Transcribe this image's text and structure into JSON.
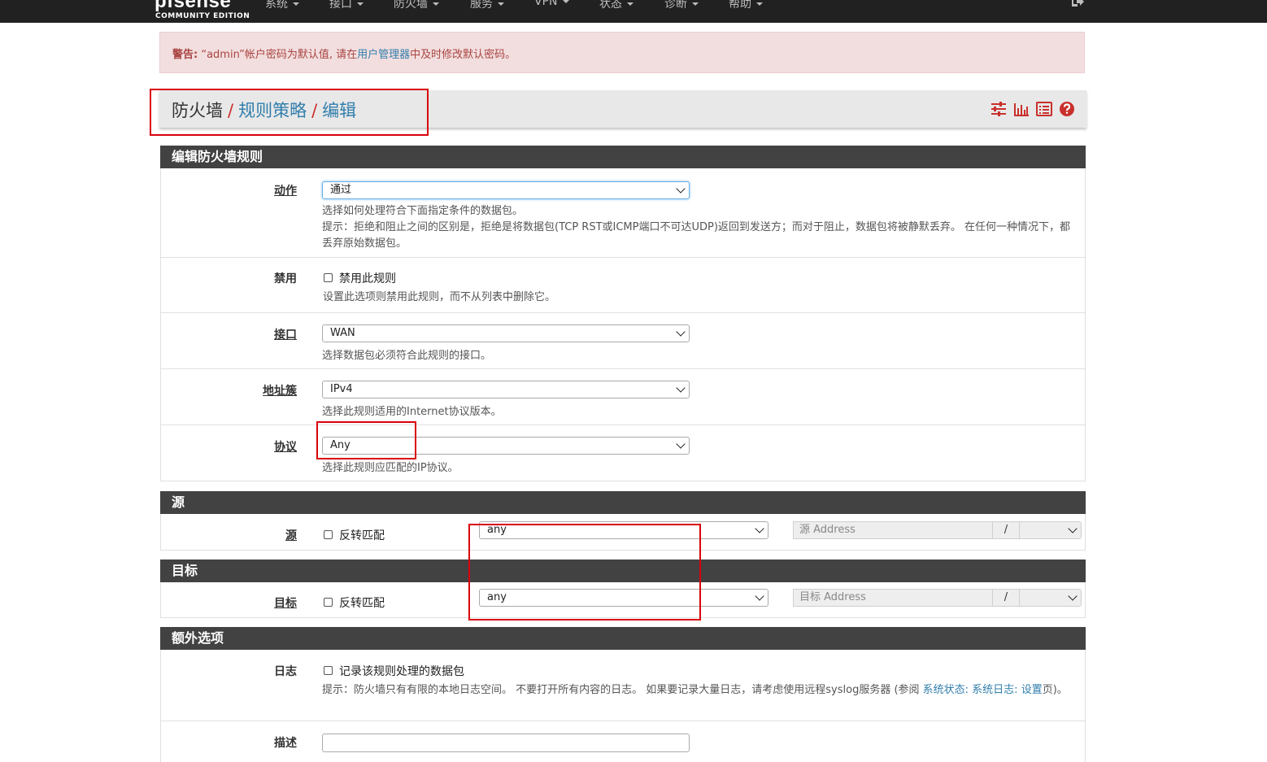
{
  "navbar": {
    "brand": "pfsense",
    "edition": "COMMUNITY EDITION",
    "menus": [
      "系统",
      "接口",
      "防火墙",
      "服务",
      "VPN",
      "状态",
      "诊断",
      "帮助"
    ]
  },
  "alert": {
    "prefix": "警告:",
    "text_before": " “admin”帐户密码为默认值, 请在",
    "link": "用户管理器",
    "text_after": "中及时修改默认密码。"
  },
  "breadcrumb": {
    "root": "防火墙",
    "sep": "/",
    "level2": "规则策略",
    "level3": "编辑"
  },
  "sections": {
    "edit": "编辑防火墙规则",
    "source": "源",
    "destination": "目标",
    "extra": "额外选项"
  },
  "fields": {
    "action": {
      "label": "动作",
      "value": "通过",
      "help1": "选择如何处理符合下面指定条件的数据包。",
      "help2": "提示：拒绝和阻止之间的区别是，拒绝是将数据包(TCP RST或ICMP端口不可达UDP)返回到发送方；而对于阻止，数据包将被静默丢弃。 在任何一种情况下，都丢弃原始数据包。"
    },
    "disabled": {
      "label": "禁用",
      "checkbox": "禁用此规则",
      "help": "设置此选项则禁用此规则，而不从列表中删除它。"
    },
    "interface": {
      "label": "接口",
      "value": "WAN",
      "help": "选择数据包必须符合此规则的接口。"
    },
    "family": {
      "label": "地址簇",
      "value": "IPv4",
      "help": "选择此规则适用的Internet协议版本。"
    },
    "protocol": {
      "label": "协议",
      "value": "Any",
      "help": "选择此规则应匹配的IP协议。"
    },
    "source": {
      "label": "源",
      "invert": "反转匹配",
      "value": "any",
      "address_placeholder": "源 Address",
      "slash": "/"
    },
    "destination": {
      "label": "目标",
      "invert": "反转匹配",
      "value": "any",
      "address_placeholder": "目标 Address",
      "slash": "/"
    },
    "log": {
      "label": "日志",
      "checkbox": "记录该规则处理的数据包",
      "help_before": "提示：防火墙只有有限的本地日志空间。 不要打开所有内容的日志。 如果要记录大量日志，请考虑使用远程syslog服务器 (参阅 ",
      "help_link": "系统状态: 系统日志: 设置",
      "help_after": "页)。"
    },
    "description": {
      "label": "描述",
      "value": ""
    }
  },
  "colors": {
    "navbar": "#212121",
    "panel_header": "#424242",
    "link": "#317eac",
    "annotation_box": "#d9000d",
    "alert_bg": "#f2dede"
  }
}
